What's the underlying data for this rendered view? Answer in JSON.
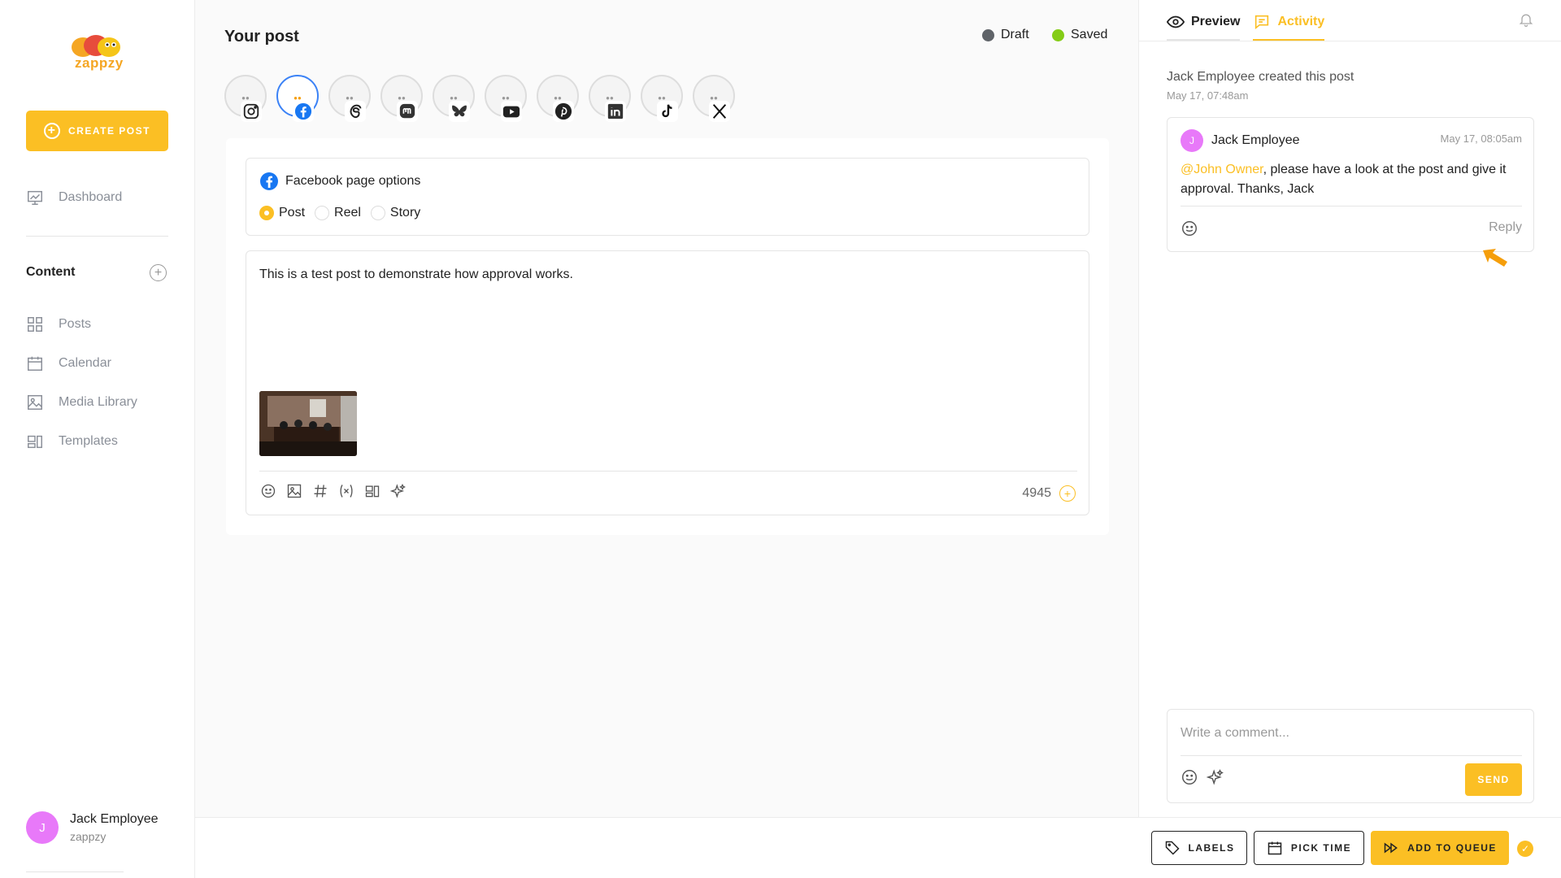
{
  "app": {
    "logo_text": "zappzy"
  },
  "sidebar": {
    "create_label": "CREATE POST",
    "dashboard_label": "Dashboard",
    "section_title": "Content",
    "items": [
      {
        "label": "Posts",
        "icon": "grid-icon"
      },
      {
        "label": "Calendar",
        "icon": "calendar-icon"
      },
      {
        "label": "Media Library",
        "icon": "image-icon"
      },
      {
        "label": "Templates",
        "icon": "templates-icon"
      }
    ],
    "user": {
      "initial": "J",
      "name": "Jack Employee",
      "org": "zappzy"
    }
  },
  "main": {
    "title": "Your post",
    "status": [
      {
        "label": "Draft",
        "color": "#5f6368"
      },
      {
        "label": "Saved",
        "color": "#84cc16"
      }
    ],
    "channels": [
      {
        "name": "instagram",
        "icon": "instagram-icon"
      },
      {
        "name": "facebook",
        "icon": "facebook-icon",
        "active": true
      },
      {
        "name": "threads",
        "icon": "threads-icon"
      },
      {
        "name": "mastodon",
        "icon": "mastodon-icon"
      },
      {
        "name": "bluesky",
        "icon": "bluesky-icon"
      },
      {
        "name": "youtube",
        "icon": "youtube-icon"
      },
      {
        "name": "pinterest",
        "icon": "pinterest-icon"
      },
      {
        "name": "linkedin",
        "icon": "linkedin-icon"
      },
      {
        "name": "tiktok",
        "icon": "tiktok-icon"
      },
      {
        "name": "x",
        "icon": "x-icon"
      }
    ],
    "fb_options_title": "Facebook page options",
    "post_types": [
      {
        "label": "Post",
        "checked": true
      },
      {
        "label": "Reel",
        "checked": false
      },
      {
        "label": "Story",
        "checked": false
      }
    ],
    "post_text": "This is a test post to demonstrate how approval works.",
    "char_counter": "4945"
  },
  "panel": {
    "tabs": [
      {
        "label": "Preview",
        "icon": "eye-icon",
        "active": false
      },
      {
        "label": "Activity",
        "icon": "comment-icon",
        "active": true
      }
    ],
    "activity_head": "Jack Employee created this post",
    "activity_time": "May 17, 07:48am",
    "comment": {
      "initial": "J",
      "author": "Jack Employee",
      "time": "May 17, 08:05am",
      "mention": "@John Owner",
      "text": ", please have a look at the post and give it approval. Thanks, Jack",
      "reply_label": "Reply"
    },
    "comment_placeholder": "Write a comment...",
    "send_label": "SEND"
  },
  "bottom": {
    "labels_label": "LABELS",
    "pick_time_label": "PICK TIME",
    "queue_label": "ADD TO QUEUE"
  },
  "colors": {
    "accent": "#fbbf24",
    "avatar": "#e879f9",
    "facebook": "#1877f2"
  }
}
